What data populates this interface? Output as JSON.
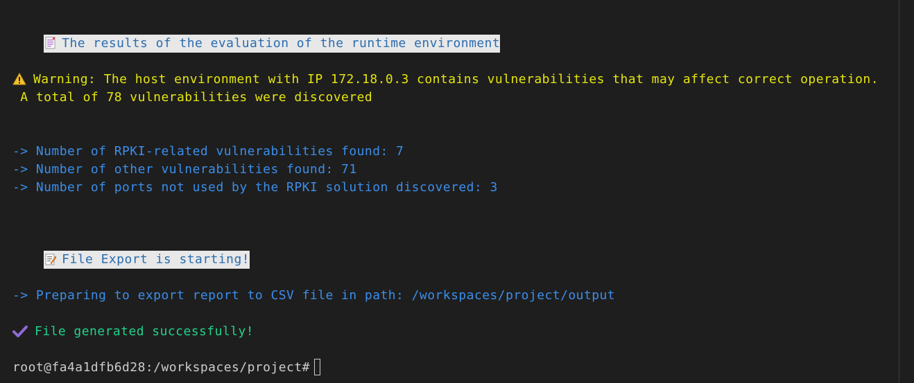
{
  "terminal": {
    "header_evaluation": "The results of the evaluation of the runtime environment",
    "warning_line1": "Warning: The host environment with IP 172.18.0.3 contains vulnerabilities that may affect correct operation.",
    "warning_line2": " A total of 78 vulnerabilities were discovered",
    "findings": [
      "-> Number of RPKI-related vulnerabilities found: 7",
      "-> Number of other vulnerabilities found: 71",
      "-> Number of ports not used by the RPKI solution discovered: 3"
    ],
    "header_export": "File Export is starting!",
    "export_info": "-> Preparing to export report to CSV file in path: /workspaces/project/output",
    "success_message": "File generated successfully!",
    "prompt": "root@fa4a1dfb6d28:/workspaces/project#"
  },
  "colors": {
    "background": "#1e1e1e",
    "header_bg": "#e8e8e8",
    "header_text": "#2b6cb0",
    "warning": "#e5e510",
    "info": "#3b8eea",
    "success": "#23d18b",
    "prompt": "#cccccc"
  },
  "icons": {
    "evaluation_header": "document-icon",
    "warning": "warning-icon",
    "export_header": "memo-pencil-icon",
    "success": "checkmark-icon"
  }
}
